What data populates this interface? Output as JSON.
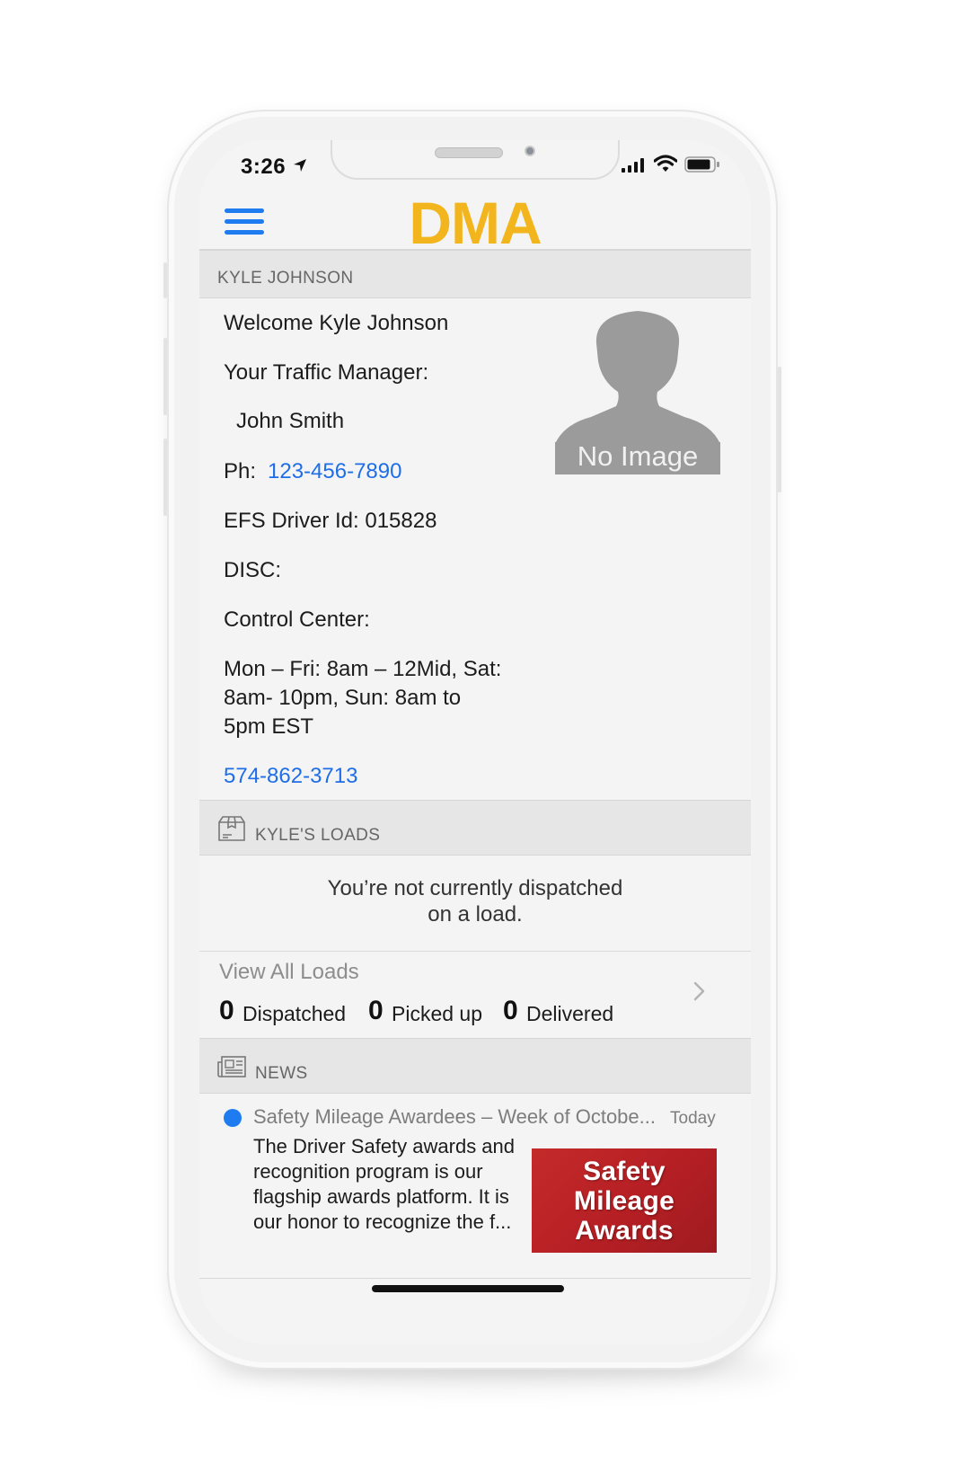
{
  "status_bar": {
    "time": "3:26"
  },
  "header": {
    "logo": "DMA"
  },
  "profile": {
    "section_title": "KYLE JOHNSON",
    "welcome": "Welcome Kyle Johnson",
    "manager_label": "Your Traffic Manager:",
    "manager_name": "John Smith",
    "phone_label": "Ph:",
    "phone": "123-456-7890",
    "driver_id": "EFS Driver Id: 015828",
    "disc": "DISC:",
    "control_center": "Control Center:",
    "hours": [
      "Mon – Fri: 8am – 12Mid, Sat:",
      "8am- 10pm,  Sun: 8am to",
      "5pm EST"
    ],
    "control_phone": "574-862-3713",
    "avatar_label": "No Image"
  },
  "loads": {
    "section_title": "KYLE'S LOADS",
    "empty_line1": "You’re not currently dispatched",
    "empty_line2": "on a load.",
    "view_all": "View All Loads",
    "dispatched_count": "0",
    "dispatched_label": "Dispatched",
    "picked_count": "0",
    "picked_label": "Picked up",
    "delivered_count": "0",
    "delivered_label": "Delivered"
  },
  "news": {
    "section_title": "NEWS",
    "item": {
      "title": "Safety Mileage Awardees – Week of Octobe...",
      "date": "Today",
      "body": "The Driver Safety awards and recognition program is our flagship awards platform. It is our honor to recognize the f...",
      "thumb_lines": [
        "Safety",
        "Mileage",
        "Awards"
      ]
    }
  },
  "colors": {
    "accent": "#1f7cf0",
    "logo": "#f2b51d",
    "thumb": "#c42a2a"
  }
}
